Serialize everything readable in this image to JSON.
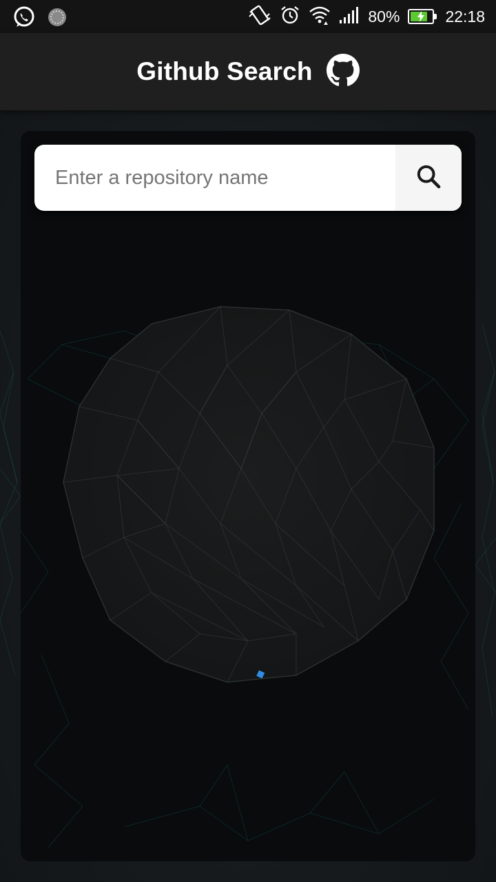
{
  "status_bar": {
    "battery_percent_text": "80%",
    "battery_level": 0.8,
    "time": "22:18",
    "icons": [
      "whatsapp-icon",
      "sync-icon",
      "vibrate-icon",
      "alarm-icon",
      "wifi-icon",
      "signal-icon",
      "battery-charging-icon"
    ]
  },
  "app_bar": {
    "title": "Github Search",
    "logo_icon": "github-icon"
  },
  "search": {
    "placeholder": "Enter a repository name",
    "value": "",
    "button_icon": "search-icon"
  },
  "loading": {
    "indicator_color": "#2f8de4"
  },
  "colors": {
    "accent_network": "#1d6e6a",
    "card_background": "#090b0c",
    "app_bar_background": "#1f1f1f"
  }
}
